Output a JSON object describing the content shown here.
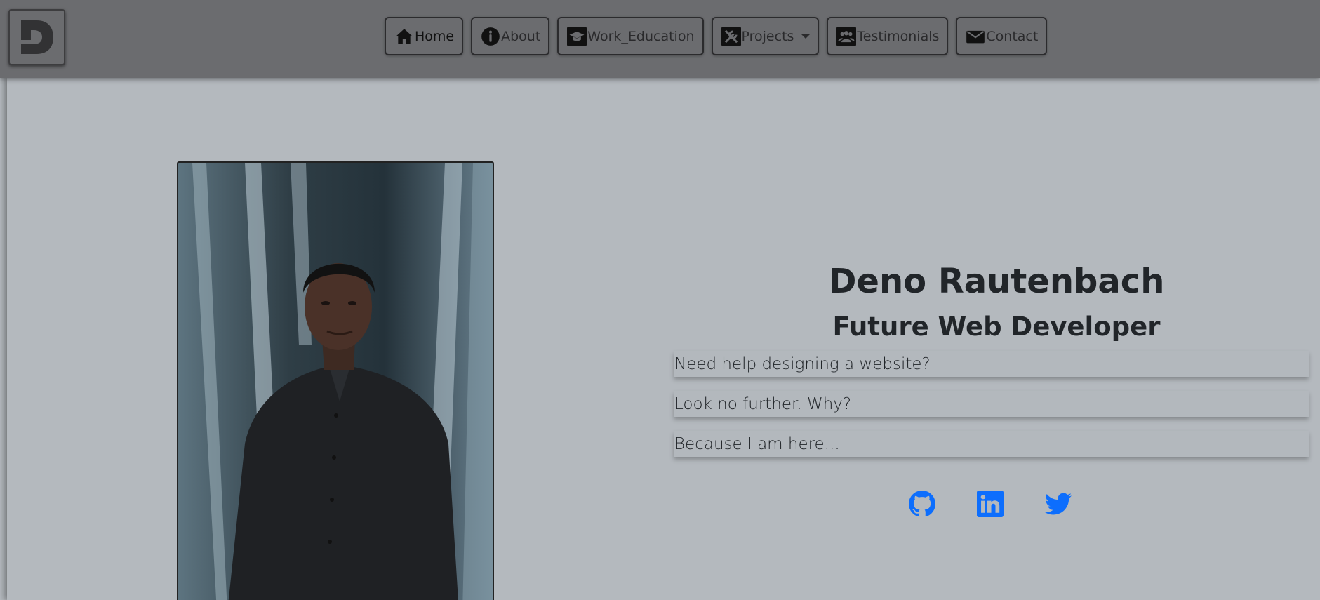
{
  "nav": {
    "items": [
      {
        "label": "Home",
        "icon": "home-icon",
        "active": true
      },
      {
        "label": "About",
        "icon": "info-icon"
      },
      {
        "label": "Work_Education",
        "icon": "graduation-cap-icon"
      },
      {
        "label": "Projects",
        "icon": "tools-icon",
        "dropdown": true
      },
      {
        "label": "Testimonials",
        "icon": "people-icon"
      },
      {
        "label": "Contact",
        "icon": "envelope-icon"
      }
    ]
  },
  "hero": {
    "name": "Deno Rautenbach",
    "title": "Future Web Developer",
    "taglines": [
      "Need help designing a website?",
      "Look no further. Why?",
      "Because I am here..."
    ]
  },
  "social": [
    {
      "icon": "github-icon"
    },
    {
      "icon": "linkedin-icon"
    },
    {
      "icon": "twitter-icon"
    }
  ],
  "colors": {
    "navbar": "#6b6c6f",
    "background": "#b4b9be",
    "text": "#212529",
    "social": "#0d6efd"
  }
}
